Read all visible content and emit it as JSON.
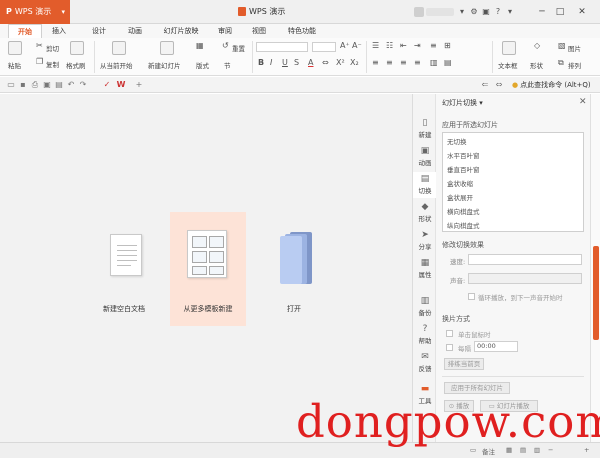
{
  "titlebar": {
    "app_name": "WPS 演示",
    "app_logo": "P",
    "window_title": "WPS 演示",
    "accent": "#e25c2b"
  },
  "menu_tabs": [
    {
      "label": "开始",
      "active": true
    },
    {
      "label": "插入"
    },
    {
      "label": "设计"
    },
    {
      "label": "动画"
    },
    {
      "label": "幻灯片放映"
    },
    {
      "label": "审阅"
    },
    {
      "label": "视图"
    },
    {
      "label": "特色功能"
    }
  ],
  "ribbon": {
    "paste": "粘贴",
    "cut": "剪切",
    "copy": "复制",
    "format_painter": "格式刷",
    "from_current": "从当前开始",
    "new_slide": "新建幻灯片",
    "layout": "版式",
    "section": "节",
    "reset": "重置",
    "text_box": "文本框",
    "shapes": "形状",
    "picture": "图片",
    "arrange": "排列"
  },
  "qat": {
    "search_command": "点此查找命令 (Alt+Q)"
  },
  "start_tiles": [
    {
      "label": "新建空白文档"
    },
    {
      "label": "从更多模板新建"
    },
    {
      "label": "打开"
    }
  ],
  "sidebar": [
    {
      "label": "新建",
      "icon": "new-doc-icon"
    },
    {
      "label": "动画",
      "icon": "animation-icon"
    },
    {
      "label": "切换",
      "icon": "transition-icon"
    },
    {
      "label": "形状",
      "icon": "shape-icon"
    },
    {
      "label": "分享",
      "icon": "share-icon"
    },
    {
      "label": "属性",
      "icon": "properties-icon"
    },
    {
      "label": "备份",
      "icon": "backup-icon"
    },
    {
      "label": "帮助",
      "icon": "help-icon"
    },
    {
      "label": "反馈",
      "icon": "feedback-icon"
    },
    {
      "label": "工具",
      "icon": "tools-icon"
    }
  ],
  "pane": {
    "title": "幻灯片切换",
    "apply_selected": "应用于所选幻灯片",
    "transitions": [
      "无切换",
      "水平百叶窗",
      "垂直百叶窗",
      "盒状收缩",
      "盒状展开",
      "横向棋盘式",
      "纵向棋盘式"
    ],
    "modify_effect": "修改切换效果",
    "speed_label": "速度:",
    "sound_label": "声音:",
    "loop_sound": "循环播放，到下一声音开始时",
    "advance_heading": "换片方式",
    "on_click": "单击鼠标时",
    "every": "每隔",
    "every_time": "00:00",
    "rehearse": "排练当前页",
    "apply_all": "应用于所有幻灯片",
    "play": "播放",
    "slideshow": "幻灯片播放"
  },
  "statusbar": {
    "notes": "备注"
  },
  "watermark": "dongpow.com"
}
